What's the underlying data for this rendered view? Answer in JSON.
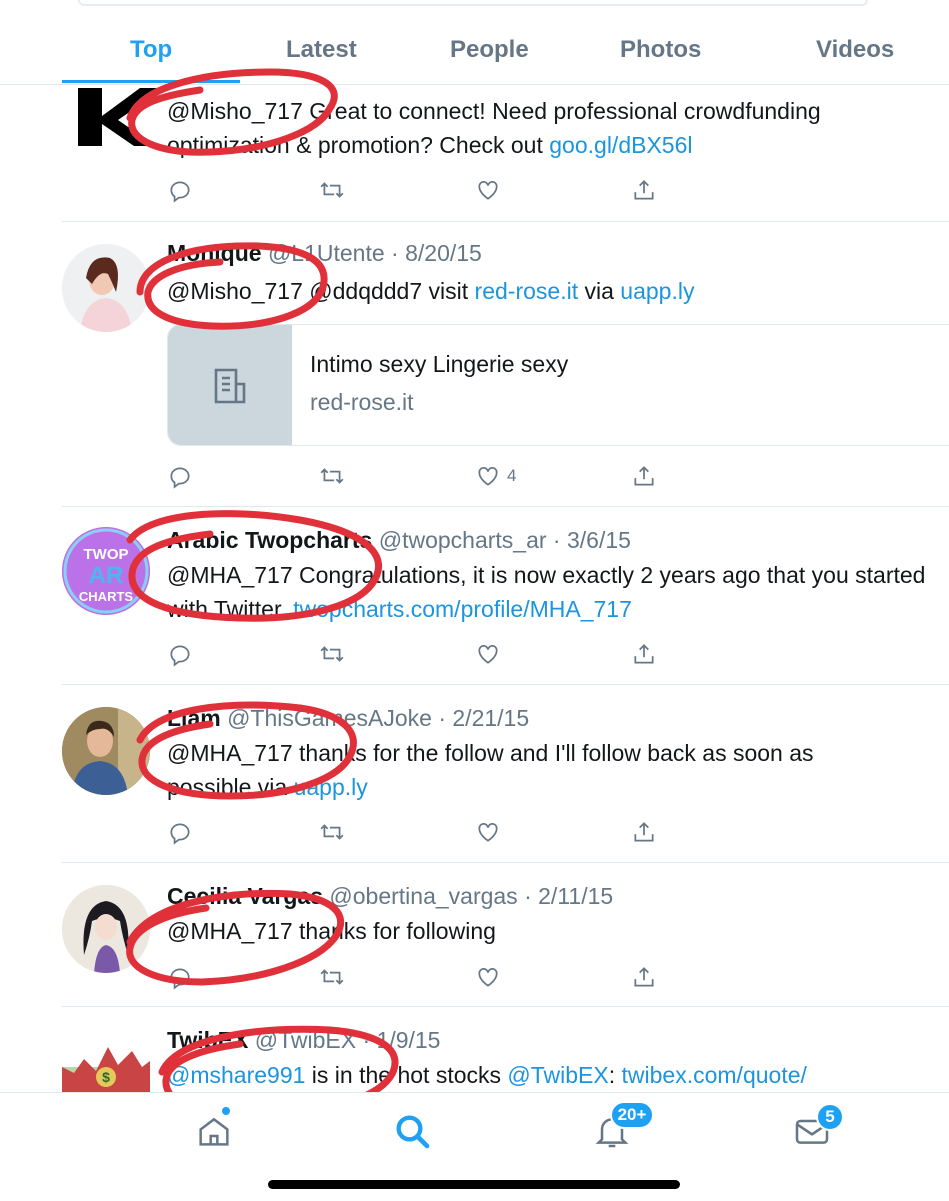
{
  "tabs": [
    "Top",
    "Latest",
    "People",
    "Photos",
    "Videos"
  ],
  "colors": {
    "accent": "#1da1f2",
    "link": "#1b95e0",
    "muted": "#657786",
    "scribble": "#e0313a"
  },
  "tweets": [
    {
      "name": "",
      "handle": "",
      "date": "",
      "text_parts": [
        "@Misho_717 Great to connect! Need professional crowdfunding optimization & promotion? Check out "
      ],
      "link": "goo.gl/dBX56l",
      "likes": ""
    },
    {
      "name": "Monique",
      "handle": "@L1Utente",
      "date": "8/20/15",
      "text_parts": [
        "@Misho_717 @ddqddd7 visit ",
        " via "
      ],
      "links": [
        "red-rose.it",
        "uapp.ly"
      ],
      "card": {
        "title": "Intimo sexy Lingerie sexy",
        "domain": "red-rose.it"
      },
      "likes": "4"
    },
    {
      "name": "Arabic Twopcharts",
      "handle": "@twopcharts_ar",
      "date": "3/6/15",
      "text": "@MHA_717 Congratulations, it is now exactly 2 years ago that you started with Twitter. ",
      "link": "twopcharts.com/profile/MHA_717",
      "avatar_text": [
        "TWOP",
        "AR",
        "CHARTS"
      ],
      "likes": ""
    },
    {
      "name": "Liam",
      "handle": "@ThisGamesAJoke",
      "date": "2/21/15",
      "text": "@MHA_717 thanks for the follow and I'll follow back as soon as possible via ",
      "link": "uapp.ly",
      "likes": ""
    },
    {
      "name": "Cecilia Vargas",
      "handle": "@obertina_vargas",
      "date": "2/11/15",
      "text": "@MHA_717 thanks for following",
      "likes": ""
    },
    {
      "name": "TwibEX",
      "handle": "@TwibEX",
      "date": "1/9/15",
      "mention": "@mshare991",
      "text_mid": " is in the hot stocks ",
      "mention2": "@TwibEX",
      "text_after": ": ",
      "link": "twibex.com/quote/",
      "likes": ""
    }
  ],
  "separator": " · ",
  "bottom_nav": {
    "items": [
      "home-icon",
      "search-icon",
      "notifications-icon",
      "messages-icon"
    ],
    "notifications_badge": "20+",
    "messages_badge": "5"
  }
}
